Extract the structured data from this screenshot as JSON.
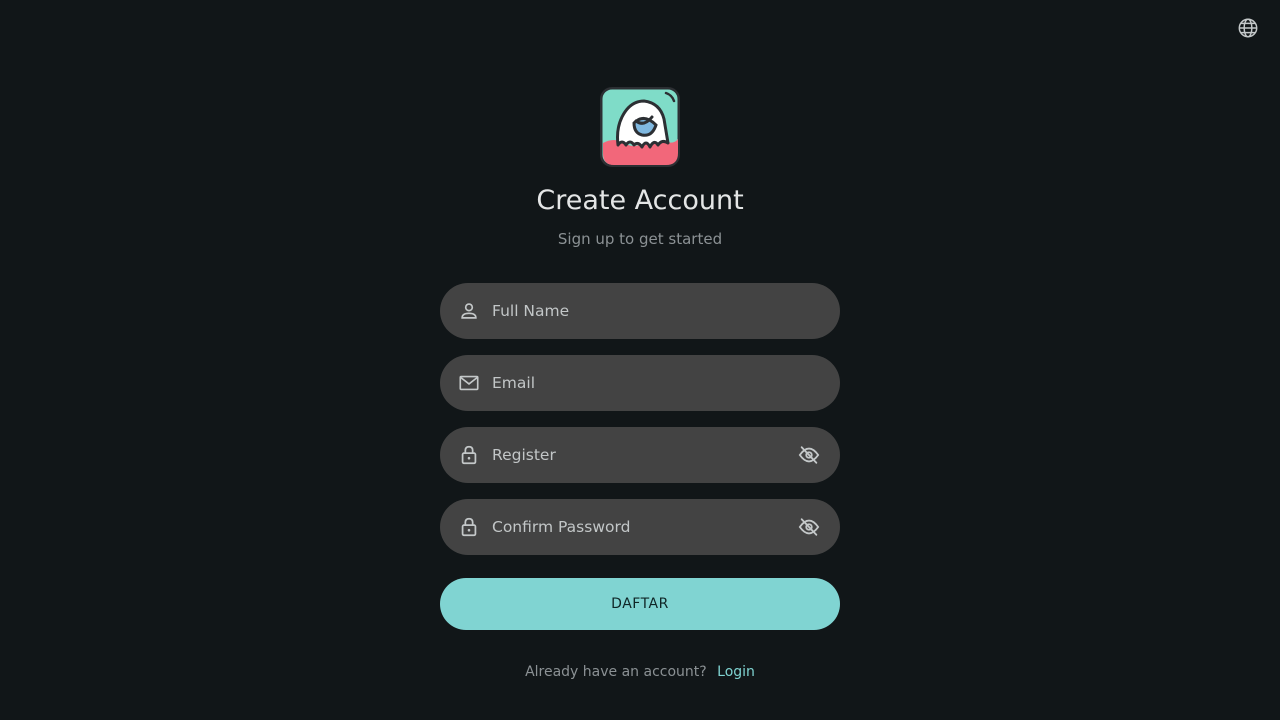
{
  "header": {
    "language_icon": "globe-icon"
  },
  "brand": {
    "logo_icon": "ghost-logo",
    "title": "Create Account",
    "subtitle": "Sign up to get started"
  },
  "form": {
    "full_name": {
      "placeholder": "Full Name",
      "icon": "person-icon"
    },
    "email": {
      "placeholder": "Email",
      "icon": "mail-icon"
    },
    "password": {
      "placeholder": "Register",
      "icon": "lock-icon",
      "toggle_icon": "eye-off-icon"
    },
    "confirm_password": {
      "placeholder": "Confirm Password",
      "icon": "lock-icon",
      "toggle_icon": "eye-off-icon"
    },
    "submit_label": "DAFTAR"
  },
  "footer": {
    "question": "Already have an account?",
    "login_label": "Login"
  },
  "colors": {
    "background": "#111618",
    "field": "#434343",
    "accent": "#80d4d2"
  }
}
